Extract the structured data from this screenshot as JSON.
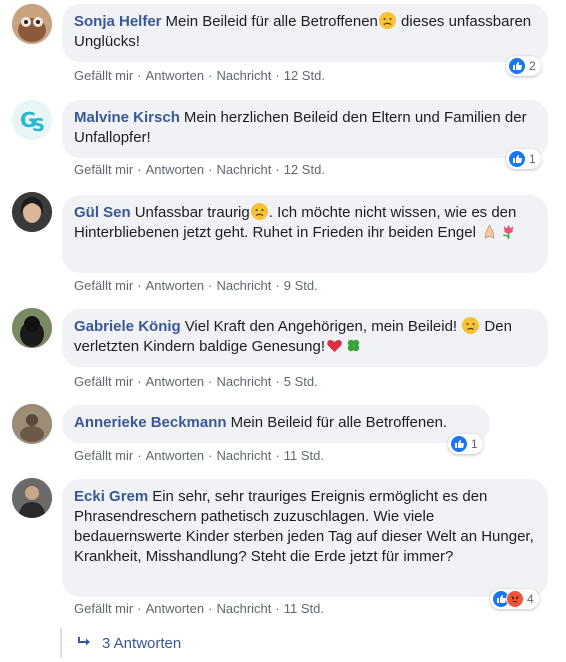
{
  "comments": [
    {
      "author": "Sonja Helfer",
      "text_a": "Mein Beileid für alle Betroffenen",
      "text_b": " dieses unfassbaren Unglücks!",
      "emoji_a": "sad-face",
      "actions": {
        "like": "Gefällt mir",
        "reply": "Antworten",
        "message": "Nachricht",
        "time": "12 Std."
      },
      "reactions": {
        "icons": [
          "like"
        ],
        "count": "2"
      }
    },
    {
      "author": "Malvine Kirsch",
      "text_a": "Mein herzlichen Beileid den Eltern und Familien der Unfallopfer!",
      "actions": {
        "like": "Gefällt mir",
        "reply": "Antworten",
        "message": "Nachricht",
        "time": "12 Std."
      },
      "reactions": {
        "icons": [
          "like"
        ],
        "count": "1"
      }
    },
    {
      "author": "Gül Sen",
      "text_a": "Unfassbar traurig",
      "text_b": ". Ich möchte nicht wissen, wie es den Hinterbliebenen jetzt geht. Ruhet in Frieden ihr beiden Engel ",
      "emoji_a": "sad-face",
      "emoji_b": [
        "praying-hands",
        "tulip"
      ],
      "actions": {
        "like": "Gefällt mir",
        "reply": "Antworten",
        "message": "Nachricht",
        "time": "9 Std."
      }
    },
    {
      "author": "Gabriele König",
      "text_a": "Viel Kraft den Angehörigen, mein Beileid! ",
      "text_b": " Den verletzten Kindern baldige Genesung!",
      "emoji_a": "crying-face",
      "emoji_b": [
        "red-heart",
        "four-leaf-clover"
      ],
      "actions": {
        "like": "Gefällt mir",
        "reply": "Antworten",
        "message": "Nachricht",
        "time": "5 Std."
      }
    },
    {
      "author": "Annerieke Beckmann",
      "text_a": "Mein Beileid für alle Betroffenen.",
      "actions": {
        "like": "Gefällt mir",
        "reply": "Antworten",
        "message": "Nachricht",
        "time": "11 Std."
      },
      "reactions": {
        "icons": [
          "like"
        ],
        "count": "1"
      }
    },
    {
      "author": "Ecki Grem",
      "text_a": "Ein sehr, sehr trauriges Ereignis ermöglicht es den Phrasendreschern pathetisch zuzuschlagen. Wie viele bedauernswerte Kinder sterben jeden Tag auf dieser Welt an Hunger, Krankheit, Misshandlung? Steht die Erde jetzt für immer?",
      "actions": {
        "like": "Gefällt mir",
        "reply": "Antworten",
        "message": "Nachricht",
        "time": "11 Std."
      },
      "reactions": {
        "icons": [
          "like",
          "angry"
        ],
        "count": "4"
      }
    }
  ],
  "replies_link": "3 Antworten",
  "colors": {
    "author": "#385898",
    "bubble": "#f0f2f5",
    "like": "#1877f2",
    "angry": "#f0553c",
    "meta": "#606770"
  }
}
